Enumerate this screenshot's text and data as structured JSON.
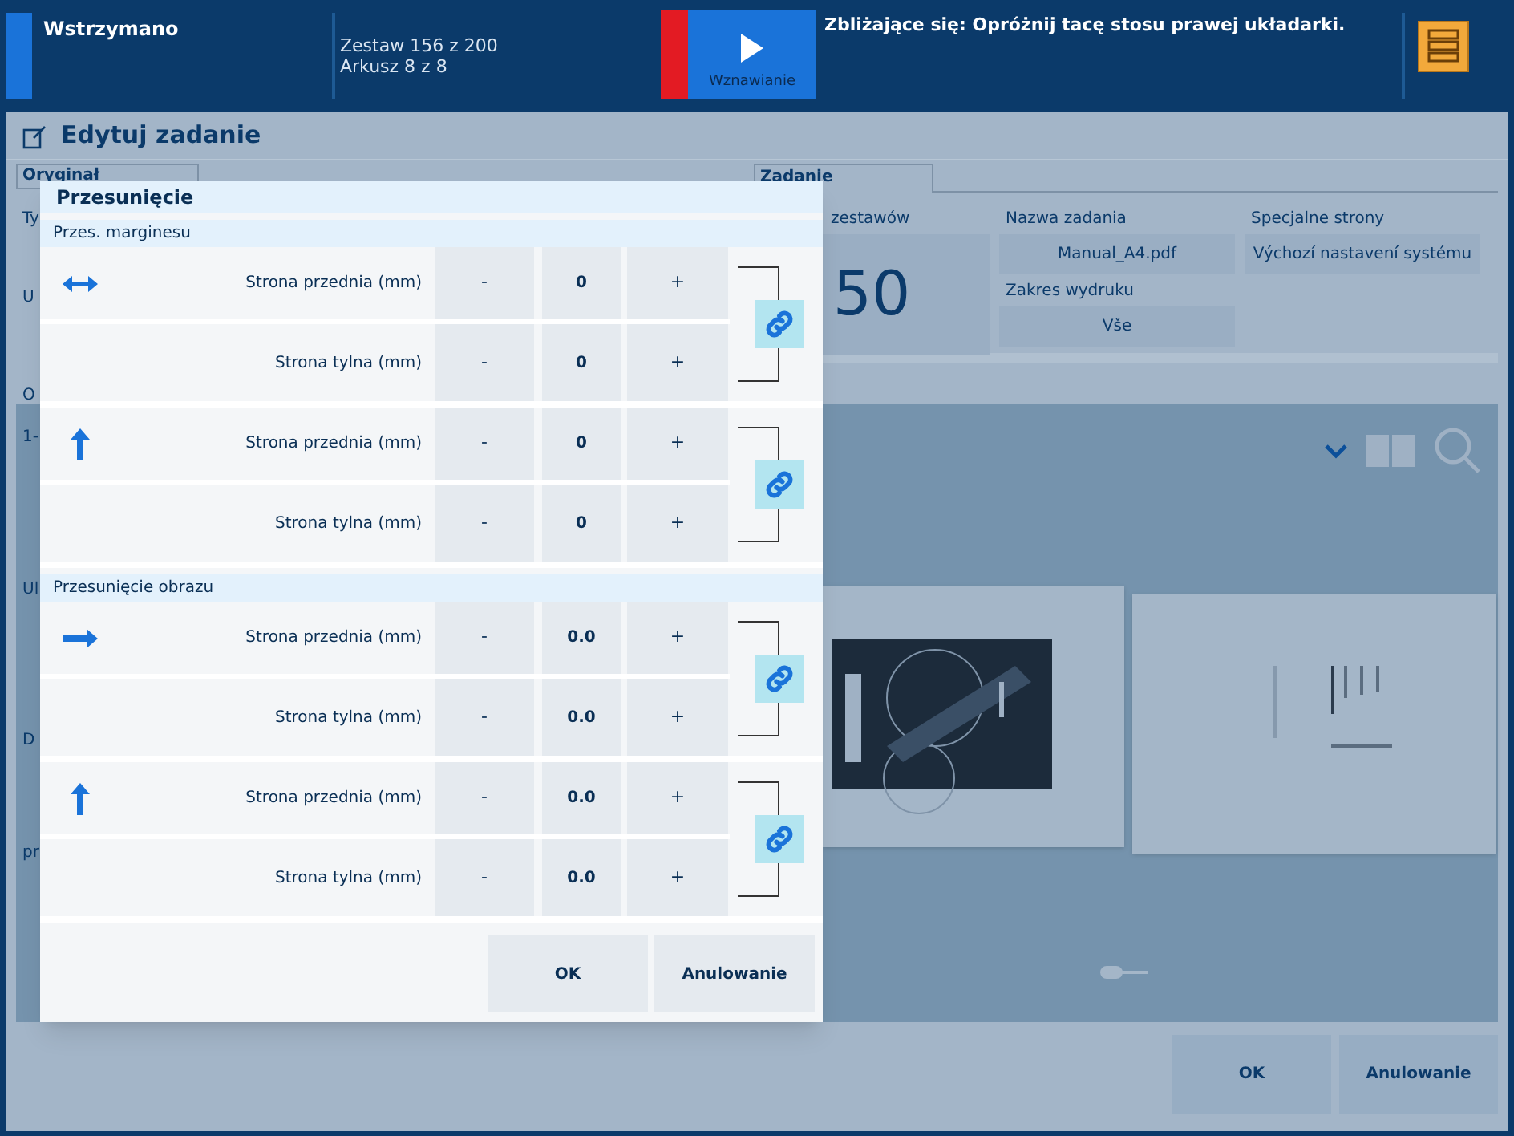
{
  "status_bar": {
    "state": "Wstrzymano",
    "set_info": "Zestaw 156 z 200",
    "sheet_info": "Arkusz 8 z 8",
    "resume_button": "Wznawianie",
    "message": "Zbliżające się: Opróżnij tacę stosu prawej układarki."
  },
  "window": {
    "title": "Edytuj zadanie"
  },
  "left_panel": {
    "tab": "Oryginał",
    "fragments": [
      "Ty",
      "U",
      "O",
      "1-",
      "Ul",
      "D",
      "pr"
    ]
  },
  "job_panel": {
    "tab": "Zadanie",
    "columns": [
      [
        {
          "label": "zestawów",
          "value": "50",
          "kind": "big"
        }
      ],
      [
        {
          "label": "Nazwa zadania",
          "value": "Manual_A4.pdf",
          "kind": "field"
        },
        {
          "label": "Zakres wydruku",
          "value": "Vše",
          "kind": "field"
        }
      ],
      [
        {
          "label": "Specjalne strony",
          "value": "Výchozí nastavení systému",
          "kind": "field"
        }
      ]
    ]
  },
  "preview": {
    "pages": [
      {
        "kind": "picture"
      },
      {
        "kind": "picture"
      }
    ]
  },
  "footer_buttons": [
    "OK",
    "Anulowanie"
  ],
  "dialog": {
    "title": "Przesunięcie",
    "sections": [
      {
        "title": "Przes. marginesu",
        "kind": "margin",
        "groups": [
          {
            "kind": "horizontal",
            "linked": true,
            "rows": [
              {
                "label": "Strona przednia (mm)",
                "minus": "-",
                "value": "0",
                "plus": "+"
              },
              {
                "label": "Strona tylna (mm)",
                "minus": "-",
                "value": "0",
                "plus": "+"
              }
            ]
          },
          {
            "kind": "vertical",
            "linked": true,
            "rows": [
              {
                "label": "Strona przednia (mm)",
                "minus": "-",
                "value": "0",
                "plus": "+"
              },
              {
                "label": "Strona tylna (mm)",
                "minus": "-",
                "value": "0",
                "plus": "+"
              }
            ]
          }
        ]
      },
      {
        "title": "Przesunięcie obrazu",
        "groups": [
          {
            "kind": "horizontal",
            "linked": true,
            "rows": [
              {
                "label": "Strona przednia (mm)",
                "minus": "-",
                "value": "0.0",
                "plus": "+"
              },
              {
                "label": "Strona tylna (mm)",
                "minus": "-",
                "value": "0.0",
                "plus": "+"
              }
            ]
          },
          {
            "kind": "vertical",
            "linked": true,
            "rows": [
              {
                "label": "Strona przednia (mm)",
                "minus": "-",
                "value": "0.0",
                "plus": "+"
              },
              {
                "label": "Strona tylna (mm)",
                "minus": "-",
                "value": "0.0",
                "plus": "+"
              }
            ]
          }
        ]
      }
    ],
    "buttons": [
      "OK",
      "Anulowanie"
    ]
  }
}
